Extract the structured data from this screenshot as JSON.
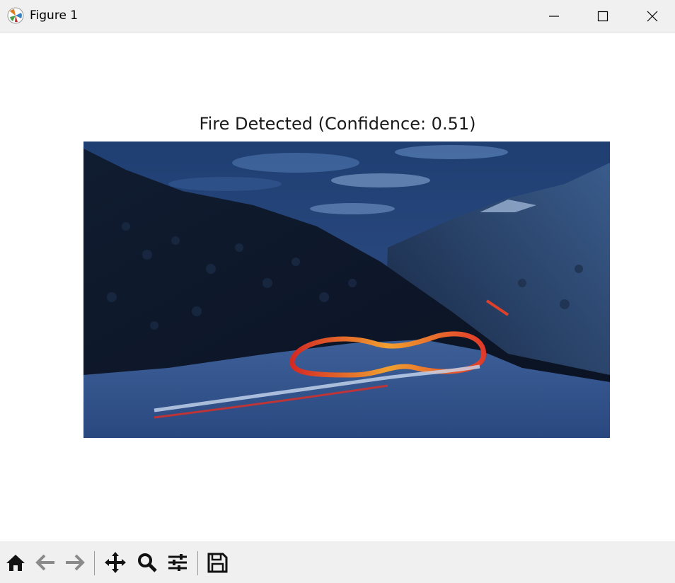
{
  "window": {
    "title": "Figure 1",
    "app_icon": "matplotlib-icon",
    "controls": [
      "minimize-icon",
      "maximize-icon",
      "close-icon"
    ]
  },
  "figure": {
    "title": "Fire Detected (Confidence: 0.51)",
    "image_subject": "night mountain valley with light trails on winding road"
  },
  "toolbar": {
    "buttons": [
      "home-icon",
      "back-icon",
      "forward-icon",
      "pan-icon",
      "zoom-icon",
      "configure-subplots-icon",
      "save-icon"
    ]
  },
  "colors": {
    "sky": "#2a4a7a",
    "forest": "#0f1a2c",
    "snow": "#5b7fb8",
    "light_trail_red": "#e0302a",
    "light_trail_yellow": "#f0b030"
  }
}
